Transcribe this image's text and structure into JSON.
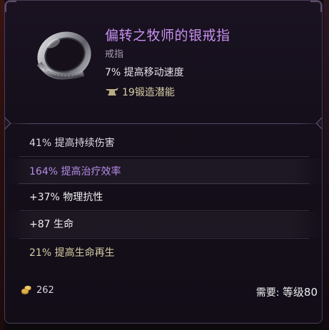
{
  "item": {
    "name": "偏转之牧师的银戒指",
    "type": "戒指",
    "base_stat": "7% 提高移动速度",
    "forge_potential": "19锻造潜能",
    "icon": "silver-ring-icon"
  },
  "affixes": [
    {
      "text": "41% 提高持续伤害",
      "color": "#dcd7e2"
    },
    {
      "text": "164% 提高治疗效率",
      "color": "#b28be6"
    },
    {
      "text": "+37% 物理抗性",
      "color": "#f0eef2"
    },
    {
      "text": "+87 生命",
      "color": "#f0eef2"
    },
    {
      "text": "21% 提高生命再生",
      "color": "#d8cfa6"
    }
  ],
  "footer": {
    "gold_value": "262",
    "gold_icon": "gold-coin-icon",
    "requirement_label": "需要: ",
    "requirement_level": "等级80"
  },
  "colors": {
    "title": "#c791f0",
    "rare_affix": "#b28be6"
  }
}
